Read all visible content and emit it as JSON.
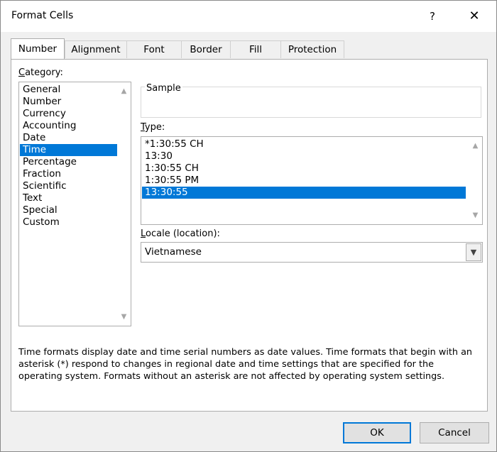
{
  "window": {
    "title": "Format Cells",
    "help_glyph": "?",
    "close_glyph": "✕"
  },
  "tabs": [
    {
      "label": "Number",
      "active": true
    },
    {
      "label": "Alignment",
      "active": false
    },
    {
      "label": "Font",
      "active": false
    },
    {
      "label": "Border",
      "active": false
    },
    {
      "label": "Fill",
      "active": false
    },
    {
      "label": "Protection",
      "active": false
    }
  ],
  "category": {
    "label_first": "C",
    "label_rest": "ategory:",
    "items": [
      "General",
      "Number",
      "Currency",
      "Accounting",
      "Date",
      "Time",
      "Percentage",
      "Fraction",
      "Scientific",
      "Text",
      "Special",
      "Custom"
    ],
    "selected": "Time"
  },
  "sample": {
    "label": "Sample",
    "value": ""
  },
  "type": {
    "label_first": "T",
    "label_rest": "ype:",
    "items": [
      "*1:30:55 CH",
      "13:30",
      "1:30:55 CH",
      "1:30:55 PM",
      "13:30:55"
    ],
    "selected": "13:30:55"
  },
  "locale": {
    "label_first": "L",
    "label_rest": "ocale (location):",
    "value": "Vietnamese"
  },
  "description": "Time formats display date and time serial numbers as date values.  Time formats that begin with an asterisk (*) respond to changes in regional date and time settings that are specified for the operating system. Formats without an asterisk are not affected by operating system settings.",
  "buttons": {
    "ok": "OK",
    "cancel": "Cancel"
  },
  "colors": {
    "selection": "#0078d7",
    "default_button_border": "#0078d7"
  }
}
